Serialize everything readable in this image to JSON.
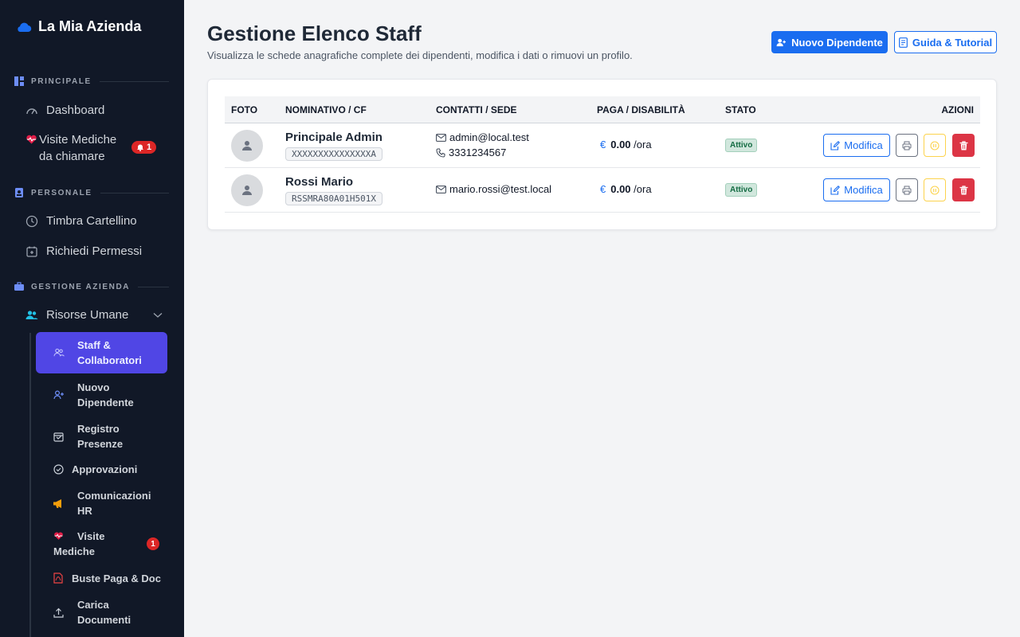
{
  "sidebar": {
    "brand": "La Mia Azienda",
    "sections": [
      {
        "label": "PRINCIPALE"
      },
      {
        "label": "PERSONALE"
      },
      {
        "label": "GESTIONE AZIENDA"
      }
    ],
    "items": [
      {
        "label": "Dashboard",
        "icon": "gauge-icon"
      },
      {
        "label": "Visite Mediche",
        "label2": "da chiamare",
        "icon": "heart-pulse-icon",
        "badge": "1"
      },
      {
        "label": "Timbra Cartellino",
        "icon": "clock-icon"
      },
      {
        "label": "Richiedi Permessi",
        "icon": "calendar-plus-icon"
      },
      {
        "label": "Risorse Umane",
        "icon": "people-icon"
      }
    ],
    "subitems": [
      {
        "label1": "Staff &",
        "label2": "Collaboratori",
        "icon": "people-icon",
        "active": true
      },
      {
        "label1": "Nuovo",
        "label2": "Dipendente",
        "icon": "person-plus-icon"
      },
      {
        "label1": "Registro",
        "label2": "Presenze",
        "icon": "calendar-check-icon"
      },
      {
        "label1": "Approvazioni",
        "label2": "",
        "icon": "check-circle-icon"
      },
      {
        "label1": "Comunicazioni",
        "label2": "HR",
        "icon": "megaphone-icon"
      },
      {
        "label1": "Visite",
        "label2": "Mediche",
        "icon": "heart-pulse-icon",
        "badge": "1"
      },
      {
        "label1": "Buste Paga & Doc",
        "label2": "",
        "icon": "pdf-file-icon"
      },
      {
        "label1": "Carica",
        "label2": "Documenti",
        "icon": "upload-icon"
      }
    ]
  },
  "header": {
    "title": "Gestione Elenco Staff",
    "subtitle": "Visualizza le schede anagrafiche complete dei dipendenti, modifica i dati o rimuovi un profilo.",
    "new_button": "Nuovo Dipendente",
    "guide_button": "Guida & Tutorial"
  },
  "table": {
    "columns": [
      "FOTO",
      "NOMINATIVO / CF",
      "CONTATTI / SEDE",
      "PAGA / DISABILITÀ",
      "STATO",
      "AZIONI"
    ],
    "rows": [
      {
        "name": "Principale Admin",
        "cf": "XXXXXXXXXXXXXXXA",
        "email": "admin@local.test",
        "phone": "3331234567",
        "currency": "€",
        "pay": "0.00",
        "unit": "/ora",
        "status": "Attivo",
        "edit": "Modifica"
      },
      {
        "name": "Rossi Mario",
        "cf": "RSSMRA80A01H501X",
        "email": "mario.rossi@test.local",
        "phone": "",
        "currency": "€",
        "pay": "0.00",
        "unit": "/ora",
        "status": "Attivo",
        "edit": "Modifica"
      }
    ]
  },
  "colors": {
    "accent": "#1a6df0",
    "sidebar": "#111827",
    "active": "#5046e5",
    "danger": "#dc3545",
    "success": "#146c43"
  }
}
